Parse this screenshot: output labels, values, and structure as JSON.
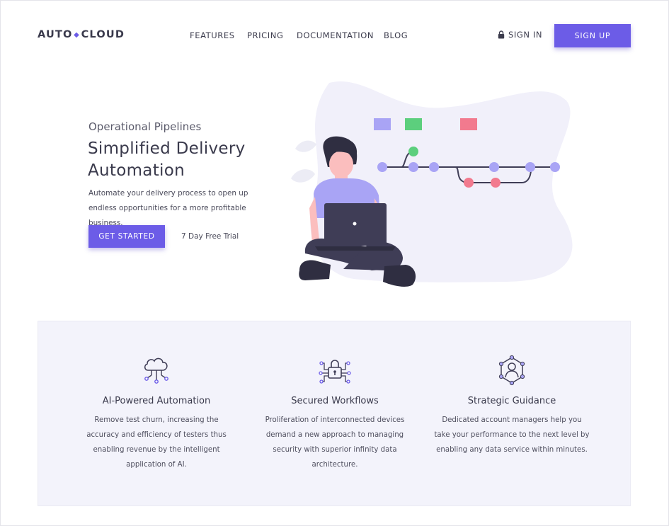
{
  "header": {
    "logo_left": "AUTO",
    "logo_sep": "◆",
    "logo_right": "CLOUD",
    "nav": [
      {
        "label": "FEATURES"
      },
      {
        "label": "PRICING"
      },
      {
        "label": "DOCUMENTATION"
      },
      {
        "label": "BLOG"
      }
    ],
    "signin_label": "SIGN IN",
    "signin_icon": "lock-icon",
    "signup_label": "SIGN UP"
  },
  "hero": {
    "eyebrow": "Operational Pipelines",
    "headline": "Simplified Delivery Automation",
    "description": "Automate your delivery process to open up endless opportunities for a more profitable business.",
    "cta_label": "GET STARTED",
    "trial_text": "7 Day Free Trial"
  },
  "features": [
    {
      "icon": "cloud-network-icon",
      "title": "AI-Powered Automation",
      "text": "Remove test churn, increasing the accuracy and efficiency of testers thus enabling revenue by the intelligent application of AI."
    },
    {
      "icon": "padlock-circuit-icon",
      "title": "Secured Workflows",
      "text": "Proliferation of interconnected devices demand a new approach to managing security with superior infinity data architecture."
    },
    {
      "icon": "user-network-icon",
      "title": "Strategic Guidance",
      "text": "Dedicated account managers help you take your performance to the next level by enabling any data service within minutes."
    }
  ],
  "colors": {
    "accent": "#6c5ce7",
    "panel_bg": "#f3f3fb",
    "text_dark": "#3a3a4c",
    "node_purple": "#a9a4f5",
    "node_green": "#5ccf7d",
    "node_red": "#f27a8e"
  }
}
